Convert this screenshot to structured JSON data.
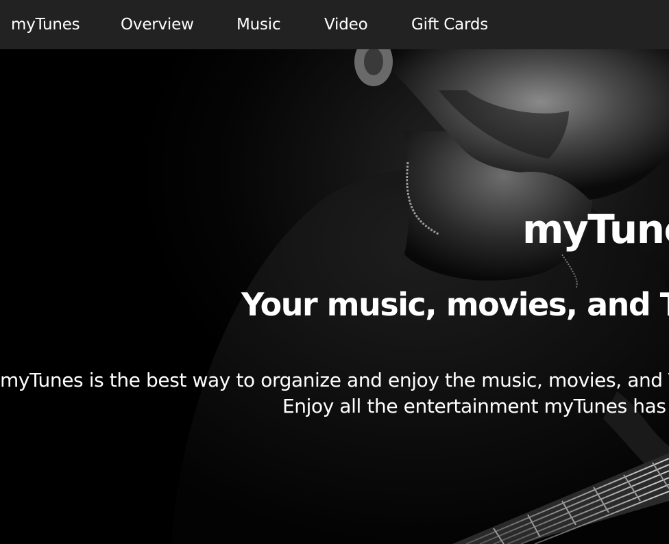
{
  "nav": {
    "brand": "myTunes",
    "items": [
      "Overview",
      "Music",
      "Video",
      "Gift Cards"
    ]
  },
  "hero": {
    "title": "myTunes",
    "subtitle": "Your music, movies, and TV shows",
    "description_line1": "myTunes is the best way to organize and enjoy the music, movies, and TV",
    "description_line2": "Enjoy all the entertainment myTunes has t"
  },
  "colors": {
    "nav_background": "#222222",
    "hero_background": "#000000",
    "text": "#ffffff"
  }
}
